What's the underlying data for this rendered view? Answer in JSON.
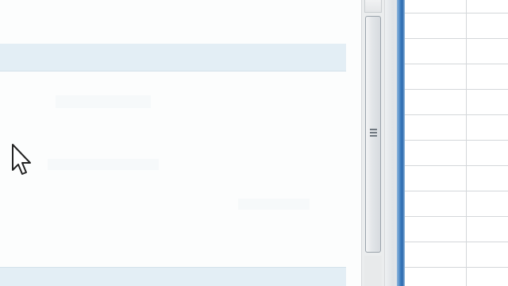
{
  "screen": {
    "description_labels": []
  },
  "content_panel": {
    "sections": [
      {
        "id": "top-section-header",
        "label": ""
      },
      {
        "id": "bottom-section-header",
        "label": ""
      }
    ]
  },
  "scrollbar": {
    "orientation": "vertical",
    "thumb_icon": "grip-lines-icon"
  },
  "spreadsheet": {
    "visible_rows": 11,
    "visible_columns": 2
  },
  "cursor": {
    "icon": "arrow-cursor-icon"
  },
  "colors": {
    "section_bar": "#e3eef5",
    "window_edge": "#3f7ec0",
    "grid_line": "#d4d7da"
  }
}
